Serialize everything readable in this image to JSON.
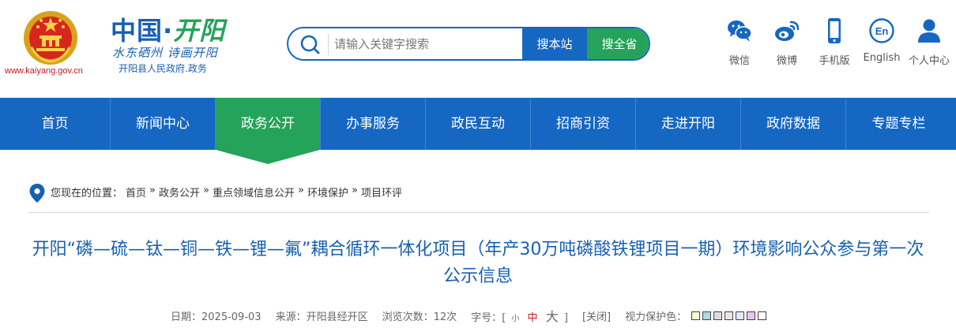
{
  "header": {
    "site_url": "www.kaiyang.gov.cn",
    "brand_main": "中国·",
    "brand_accent": "开阳",
    "slogan": "水东硒州 诗画开阳",
    "subtitle": "开阳县人民政府.政务",
    "search": {
      "placeholder": "请输入关键字搜索",
      "site_button": "搜本站",
      "province_button": "搜全省"
    },
    "tools": [
      {
        "label": "微信",
        "icon": "wechat-icon"
      },
      {
        "label": "微博",
        "icon": "weibo-icon"
      },
      {
        "label": "手机版",
        "icon": "mobile-icon"
      },
      {
        "label": "English",
        "icon": "english-icon"
      },
      {
        "label": "个人中心",
        "icon": "user-icon"
      }
    ]
  },
  "nav": {
    "items": [
      "首页",
      "新闻中心",
      "政务公开",
      "办事服务",
      "政民互动",
      "招商引资",
      "走进开阳",
      "政府数据",
      "专题专栏"
    ],
    "active": "政务公开"
  },
  "breadcrumb": {
    "prefix": "您现在的位置：",
    "items": [
      "首页",
      "政务公开",
      "重点领域信息公开",
      "环境保护",
      "项目环评"
    ],
    "separator": "»"
  },
  "article": {
    "title": "开阳“磷—硫—钛—铜—铁—锂—氟”耦合循环一体化项目（年产30万吨磷酸铁锂项目一期）环境影响公众参与第一次公示信息",
    "date_label": "日期：",
    "date": "2025-09-03",
    "source_label": "来源：",
    "source": "开阳县经开区",
    "views_label": "浏览次数：",
    "views": "12次",
    "font_label": "字号：",
    "font_open": "[",
    "font_small": "小",
    "font_medium": "中",
    "font_large": "大",
    "font_close": "]",
    "close": "[关闭]",
    "eye_label": "视力保护色：",
    "eye_colors": [
      "#fafad2",
      "#add8e6",
      "#dcdcdc",
      "#f0e0e8",
      "#e6e6fa",
      "#e3c6f5",
      "#ffffff"
    ]
  },
  "colors": {
    "primary": "#1667c1",
    "accent_green": "#25a35a",
    "url_red": "#c8161d"
  }
}
